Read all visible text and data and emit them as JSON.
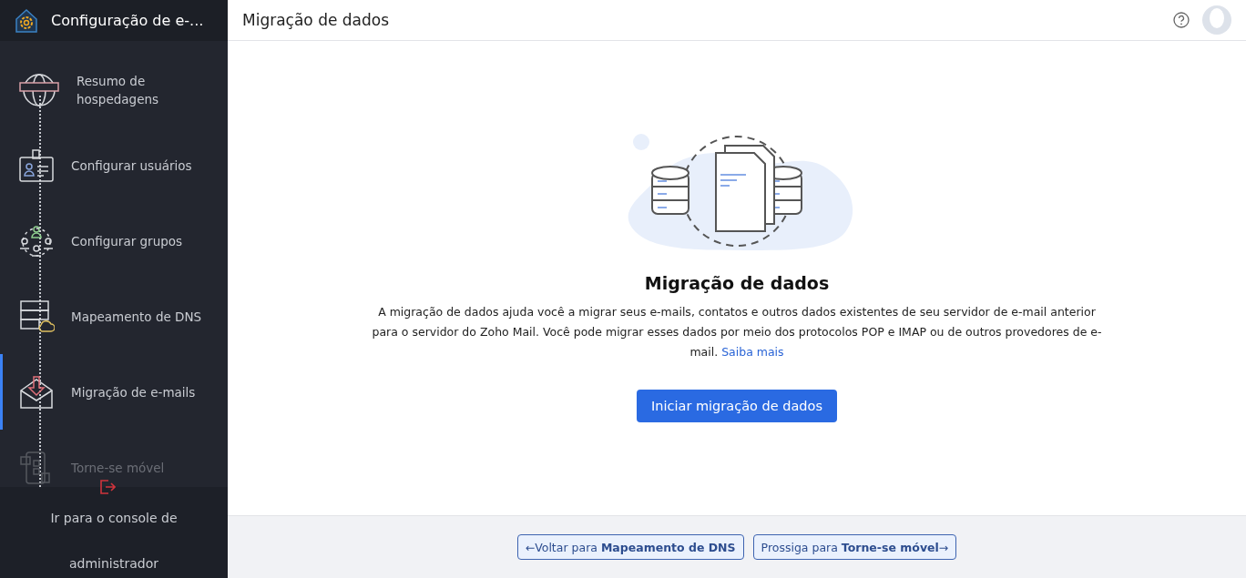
{
  "sidebar": {
    "title": "Configuração de e-...",
    "steps": [
      {
        "kind": "globe",
        "label": "Resumo de hospedagens",
        "selected": false,
        "disabled": false
      },
      {
        "kind": "users",
        "label": "Configurar usuários",
        "selected": false,
        "disabled": false
      },
      {
        "kind": "groups",
        "label": "Configurar grupos",
        "selected": false,
        "disabled": false
      },
      {
        "kind": "dns",
        "label": "Mapeamento de DNS",
        "selected": false,
        "disabled": false
      },
      {
        "kind": "mail",
        "label": "Migração de e-mails",
        "selected": true,
        "disabled": false
      },
      {
        "kind": "mobile",
        "label": "Torne-se móvel",
        "selected": false,
        "disabled": true
      }
    ],
    "footer_link": "Ir para o console de administrador"
  },
  "header": {
    "title": "Migração de dados"
  },
  "content": {
    "heading": "Migração de dados",
    "description": "A migração de dados ajuda você a migrar seus e-mails, contatos e outros dados existentes de seu servidor de e-mail anterior para o servidor do Zoho Mail. Você pode migrar esses dados por meio dos protocolos POP e IMAP ou de outros provedores de e-mail.",
    "link": "Saiba mais",
    "button": "Iniciar migração de dados"
  },
  "footer": {
    "back": "←Voltar para **Mapeamento de DNS**",
    "next": "Prossiga para **Torne-se móvel**→"
  }
}
